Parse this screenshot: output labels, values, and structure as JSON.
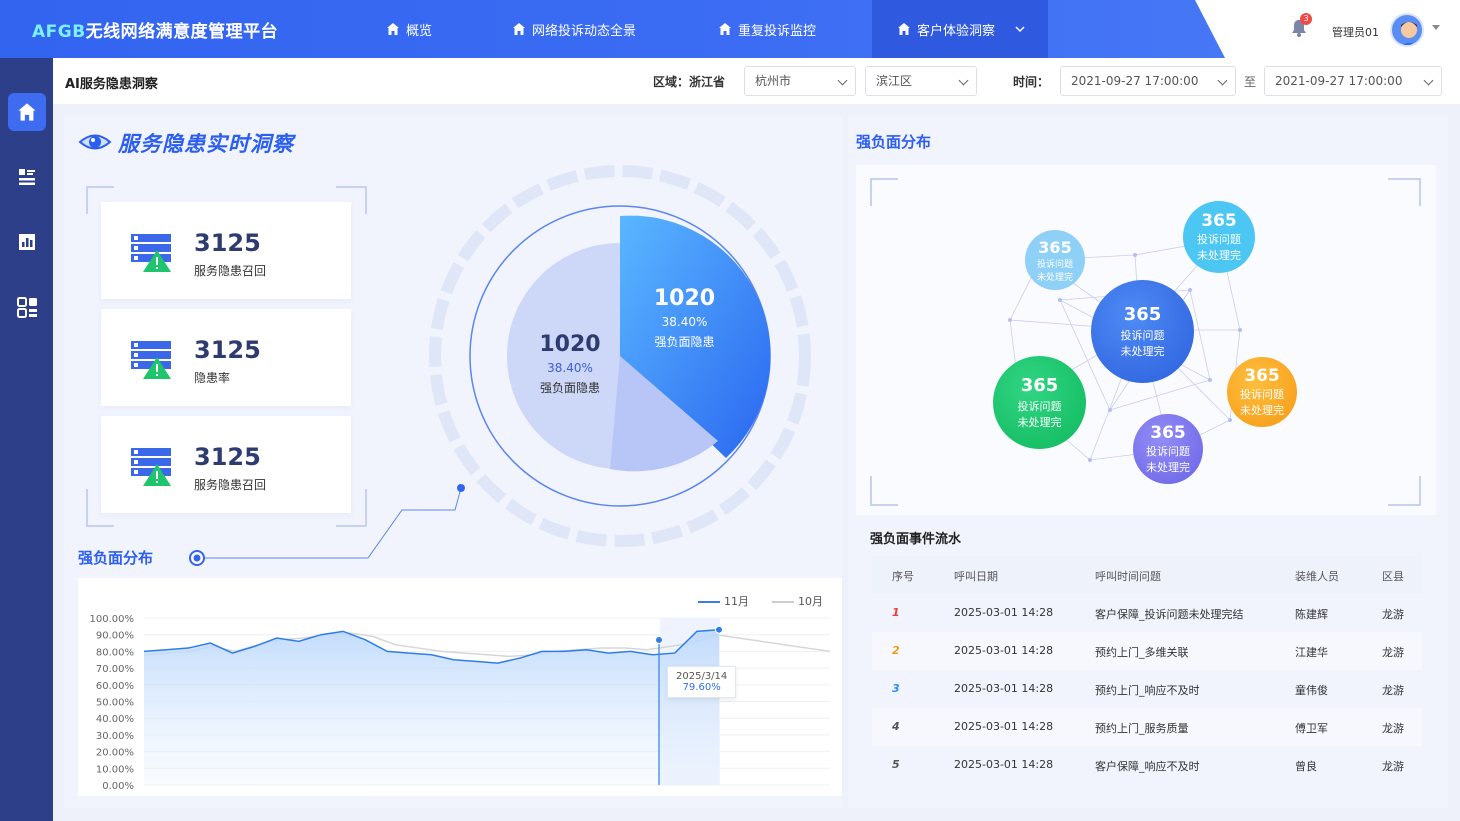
{
  "app": {
    "brand_en": "AFGB",
    "brand_cn": "无线网络满意度管理平台"
  },
  "nav": [
    {
      "label": "概览"
    },
    {
      "label": "网络投诉动态全景"
    },
    {
      "label": "重复投诉监控"
    },
    {
      "label": "客户体验洞察"
    }
  ],
  "user": {
    "notifications": "3",
    "name": "管理员01"
  },
  "page": {
    "title": "AI服务隐患洞察"
  },
  "filters": {
    "region_label": "区域：",
    "province": "浙江省",
    "city": "杭州市",
    "district": "滨江区",
    "time_label": "时间：",
    "start": "2021-09-27  17:00:00",
    "to": "至",
    "end": "2021-09-27  17:00:00"
  },
  "insight": {
    "title": "服务隐患实时洞察",
    "cards": [
      {
        "value": "3125",
        "label": "服务隐患召回"
      },
      {
        "value": "3125",
        "label": "隐患率"
      },
      {
        "value": "3125",
        "label": "服务隐患召回"
      }
    ],
    "pie": {
      "big": {
        "value": "1020",
        "percent": "38.40%",
        "label": "强负面隐患"
      },
      "small": {
        "value": "1020",
        "percent": "38.40%",
        "label": "强负面隐患"
      }
    }
  },
  "trend": {
    "title": "强负面分布",
    "legend": [
      "11月",
      "10月"
    ],
    "tooltip": {
      "date": "2025/3/14",
      "value": "79.60%"
    }
  },
  "chart_data": {
    "type": "area",
    "yticks": [
      "100.00%",
      "90.00%",
      "80.00%",
      "70.00%",
      "60.00%",
      "50.00%",
      "40.00%",
      "30.00%",
      "20.00%",
      "10.00%",
      "0.00%"
    ],
    "ylim": [
      0,
      100
    ],
    "series": [
      {
        "name": "11月",
        "values": [
          80,
          81,
          82,
          85,
          79,
          83,
          88,
          86,
          90,
          92,
          87,
          80,
          79,
          78,
          75,
          74,
          73,
          76,
          80,
          80,
          81,
          79,
          80,
          78,
          79,
          92,
          93
        ]
      },
      {
        "name": "10月",
        "values": [
          78,
          79,
          80,
          83,
          80,
          84,
          87,
          88,
          90,
          91,
          89,
          84,
          82,
          80,
          79,
          78,
          77,
          78,
          80,
          81,
          82,
          82,
          81,
          83,
          85,
          90,
          88,
          86,
          84,
          82,
          80
        ]
      }
    ]
  },
  "right": {
    "title": "强负面分布",
    "bubbles": [
      {
        "value": "365",
        "l1": "投诉问题",
        "l2": "未处理完",
        "color": "#8fd0f6"
      },
      {
        "value": "365",
        "l1": "投诉问题",
        "l2": "未处理完",
        "color": "#4cc6f3"
      },
      {
        "value": "365",
        "l1": "投诉问题",
        "l2": "未处理完",
        "color": "#3670e8"
      },
      {
        "value": "365",
        "l1": "投诉问题",
        "l2": "未处理完",
        "color": "#18c86d"
      },
      {
        "value": "365",
        "l1": "投诉问题",
        "l2": "未处理完",
        "color": "#f8a826"
      },
      {
        "value": "365",
        "l1": "投诉问题",
        "l2": "未处理完",
        "color": "#7e78ee"
      }
    ],
    "table_title": "强负面事件流水",
    "headers": [
      "序号",
      "呼叫日期",
      "呼叫时间问题",
      "装维人员",
      "区县"
    ],
    "rows": [
      {
        "no": "1",
        "date": "2025-03-01 14:28",
        "issue": "客户保障_投诉问题未处理完结",
        "staff": "陈建辉",
        "area": "龙游"
      },
      {
        "no": "2",
        "date": "2025-03-01 14:28",
        "issue": "预约上门_多维关联",
        "staff": "江建华",
        "area": "龙游"
      },
      {
        "no": "3",
        "date": "2025-03-01 14:28",
        "issue": "预约上门_响应不及时",
        "staff": "童伟俊",
        "area": "龙游"
      },
      {
        "no": "4",
        "date": "2025-03-01 14:28",
        "issue": "预约上门_服务质量",
        "staff": "傅卫军",
        "area": "龙游"
      },
      {
        "no": "5",
        "date": "2025-03-01 14:28",
        "issue": "客户保障_响应不及时",
        "staff": "曾良",
        "area": "龙游"
      }
    ]
  },
  "colors": {
    "primary": "#3264f0",
    "nav": "#2e3f8a"
  }
}
